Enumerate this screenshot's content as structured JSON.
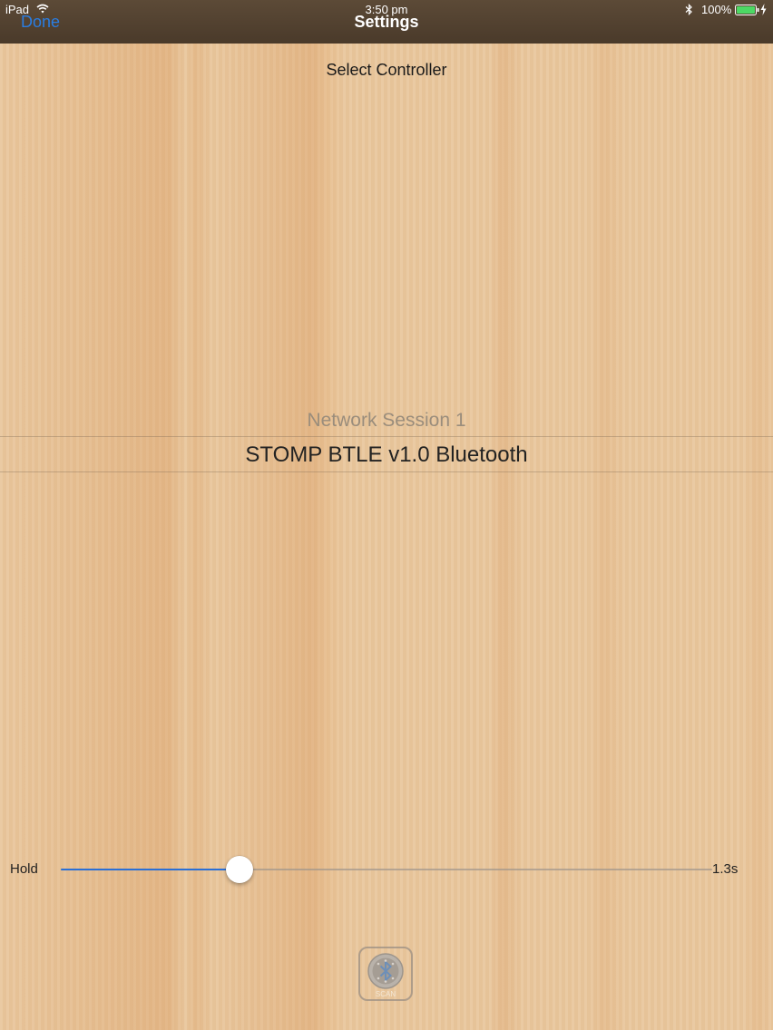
{
  "status_bar": {
    "device": "iPad",
    "time": "3:50 pm",
    "battery": "100%"
  },
  "nav": {
    "done_label": "Done",
    "title": "Settings"
  },
  "section_title": "Select Controller",
  "picker": {
    "options": [
      "Network Session 1",
      "STOMP BTLE v1.0 Bluetooth"
    ],
    "selected": "STOMP BTLE v1.0 Bluetooth"
  },
  "hold": {
    "label": "Hold",
    "value_text": "1.3s",
    "fraction": 0.275
  },
  "scan_button": {
    "label": "SCAN"
  },
  "colors": {
    "accent": "#2a6fd6",
    "nav_bar": "#4f3e2e",
    "wood": "#e9c79d"
  },
  "icons": [
    "wifi-icon",
    "bluetooth-icon",
    "battery-icon",
    "bolt-icon",
    "scan-bluetooth-icon"
  ]
}
